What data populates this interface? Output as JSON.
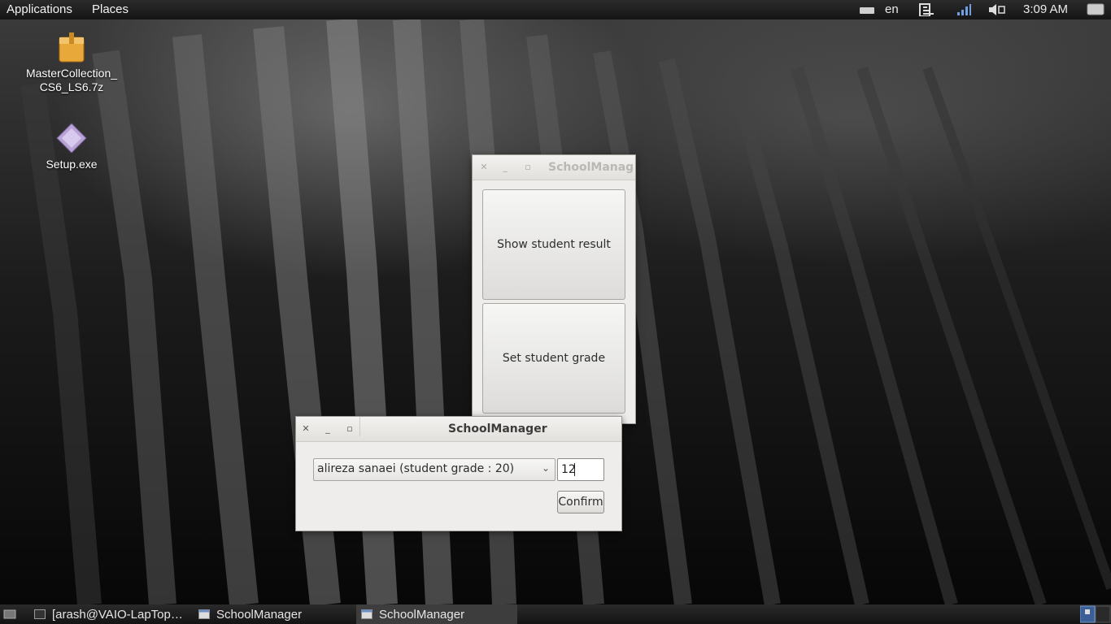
{
  "top_panel": {
    "menus": [
      "Applications",
      "Places"
    ],
    "keyboard_layout": "en",
    "clock": "3:09 AM",
    "icons": [
      "keyboard-icon",
      "network-icon",
      "signal-icon",
      "volume-muted-icon",
      "user-switch-icon"
    ]
  },
  "desktop": {
    "icons": [
      {
        "label": "MasterCollection_\nCS6_LS6.7z",
        "icon": "archive-icon"
      },
      {
        "label": "Setup.exe",
        "icon": "exe-icon"
      }
    ]
  },
  "main_window": {
    "title": "SchoolManag",
    "buttons": [
      "Show student result",
      "Set student grade"
    ]
  },
  "grade_dialog": {
    "title": "SchoolManager",
    "student_select": "alireza sanaei (student grade : 20)",
    "grade_value": "12",
    "confirm_label": "Confirm"
  },
  "taskbar": {
    "tasks": [
      {
        "label": "[arash@VAIO-LapTop…",
        "icon": "terminal-icon",
        "active": false
      },
      {
        "label": "SchoolManager",
        "icon": "window-icon",
        "active": false
      },
      {
        "label": "SchoolManager",
        "icon": "window-icon",
        "active": true
      }
    ]
  },
  "colors": {
    "panel": "#1e1e1e",
    "window_bg": "#eeedeb",
    "titlebar": "#e9e7e4"
  }
}
